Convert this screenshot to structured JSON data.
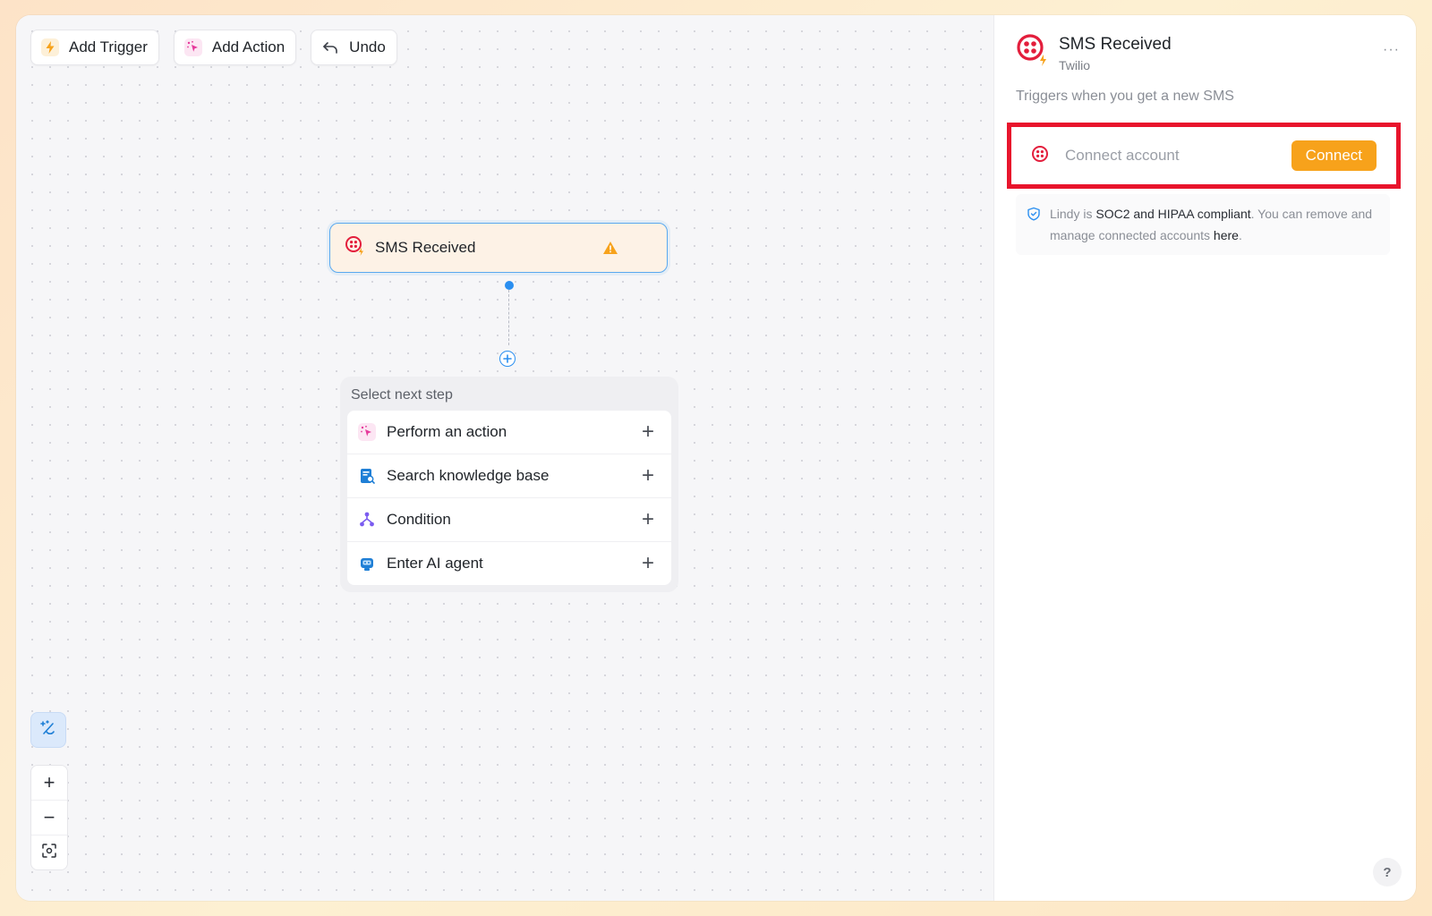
{
  "toolbar": {
    "add_trigger": "Add Trigger",
    "add_action": "Add Action",
    "undo": "Undo"
  },
  "trigger_node": {
    "title": "SMS Received",
    "status_icon": "warning-icon"
  },
  "next_step": {
    "title": "Select next step",
    "items": [
      {
        "label": "Perform an action",
        "icon": "sparkle-cursor-icon"
      },
      {
        "label": "Search knowledge base",
        "icon": "knowledge-base-icon"
      },
      {
        "label": "Condition",
        "icon": "branch-icon"
      },
      {
        "label": "Enter AI agent",
        "icon": "robot-icon"
      }
    ],
    "add_symbol": "+"
  },
  "zoom": {
    "zoom_in": "+",
    "zoom_out": "−"
  },
  "panel": {
    "title": "SMS Received",
    "subtitle": "Twilio",
    "more": "···",
    "description": "Triggers when you get a new SMS",
    "connect_placeholder": "Connect account",
    "connect_button": "Connect",
    "compliance": {
      "prefix": "Lindy is ",
      "highlight": "SOC2 and HIPAA compliant",
      "middle": ". You can remove and manage connected accounts ",
      "link": "here",
      "suffix": "."
    },
    "help": "?"
  },
  "colors": {
    "accent": "#2b8ff0",
    "twilio": "#e31e3c",
    "connect": "#f7a21b",
    "highlight_box": "#e8142c",
    "warning": "#f7a21b"
  }
}
